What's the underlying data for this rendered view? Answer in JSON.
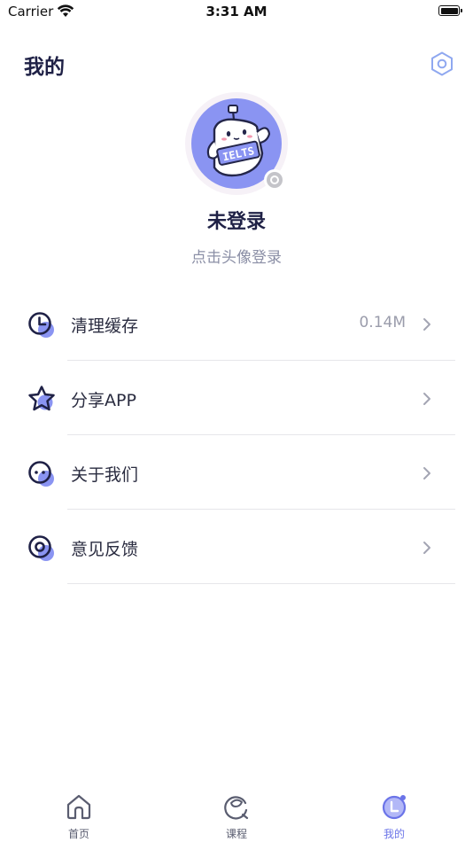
{
  "status_bar": {
    "carrier": "Carrier",
    "time": "3:31 AM"
  },
  "header": {
    "title": "我的",
    "settings_icon": "hexagon-settings-icon"
  },
  "profile": {
    "avatar_badge_text": "IELTS",
    "avatar_color": "#8a94f2",
    "name": "未登录",
    "hint": "点击头像登录"
  },
  "menu": [
    {
      "label": "清理缓存",
      "value": "0.14M",
      "icon": "clock-icon"
    },
    {
      "label": "分享APP",
      "value": "",
      "icon": "star-icon"
    },
    {
      "label": "关于我们",
      "value": "",
      "icon": "face-icon"
    },
    {
      "label": "意见反馈",
      "value": "",
      "icon": "feedback-icon"
    }
  ],
  "tabs": [
    {
      "label": "首页",
      "icon": "home-icon",
      "active": false
    },
    {
      "label": "课程",
      "icon": "course-icon",
      "active": false
    },
    {
      "label": "我的",
      "icon": "profile-icon",
      "active": true
    }
  ],
  "colors": {
    "primary": "#1f2146",
    "accent": "#6b74e8",
    "icon_fill": "#8a94f2",
    "muted_text": "#8b8fa6"
  }
}
